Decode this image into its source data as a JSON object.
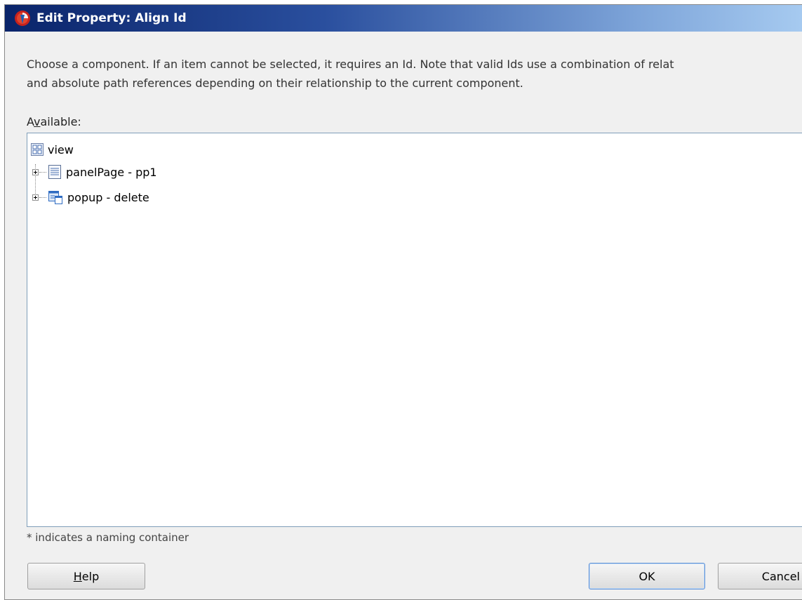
{
  "window": {
    "title": "Edit Property: Align Id",
    "icon": "oracle-jdeveloper-icon"
  },
  "description": {
    "line1": "Choose a component. If an item cannot be selected, it requires an Id. Note that valid Ids use a combination of relat",
    "line2": "and absolute path references depending on their relationship to the current component."
  },
  "available": {
    "label_before": "A",
    "label_mnemonic": "v",
    "label_after": "ailable:"
  },
  "tree": {
    "root": {
      "label": "view",
      "icon": "view-icon"
    },
    "children": [
      {
        "label": "panelPage - pp1",
        "icon": "panel-page-icon",
        "expandable": true
      },
      {
        "label": "popup - delete",
        "icon": "popup-icon",
        "expandable": true
      }
    ]
  },
  "note": "* indicates a naming container",
  "buttons": {
    "help": {
      "mnemonic": "H",
      "rest": "elp"
    },
    "ok": "OK",
    "cancel": "Cancel"
  },
  "colors": {
    "titlebar_start": "#0a246a",
    "titlebar_end": "#a6caf0",
    "dialog_bg": "#f0f0f0",
    "default_button_border": "#5b8fd6"
  }
}
